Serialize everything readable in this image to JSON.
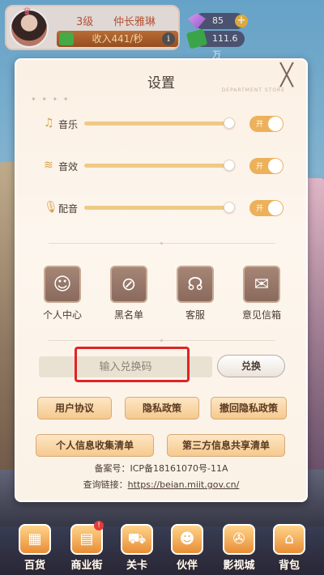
{
  "hud": {
    "level": "3级",
    "rank": "仲长雅琳",
    "income": "收入441/秒",
    "gems": "85",
    "cash": "111.6万"
  },
  "dialog": {
    "title": "设置",
    "brand_text": "DEPARTMENT STORE",
    "audio": [
      {
        "label": "音乐",
        "icon": "music-note-icon",
        "level": 1.0,
        "toggle": "开"
      },
      {
        "label": "音效",
        "icon": "sound-wave-icon",
        "level": 1.0,
        "toggle": "开"
      },
      {
        "label": "配音",
        "icon": "microphone-icon",
        "level": 1.0,
        "toggle": "开"
      }
    ],
    "tiles": [
      {
        "label": "个人中心",
        "icon": "profile-icon"
      },
      {
        "label": "黑名单",
        "icon": "blacklist-icon"
      },
      {
        "label": "客服",
        "icon": "headset-icon"
      },
      {
        "label": "意见信箱",
        "icon": "mailbox-icon"
      }
    ],
    "redeem": {
      "placeholder": "输入兑换码",
      "button": "兑换"
    },
    "buttons": {
      "user_agreement": "用户协议",
      "privacy_policy": "隐私政策",
      "revoke_privacy": "撤回隐私政策",
      "personal_info_list": "个人信息收集清单",
      "third_party_list": "第三方信息共享清单"
    },
    "record": "备案号：ICP备18161070号-11A",
    "query_label": "查询链接：",
    "query_link": "https://beian.miit.gov.cn/"
  },
  "nav": [
    {
      "label": "百货",
      "icon": "store-icon"
    },
    {
      "label": "商业街",
      "icon": "street-icon",
      "badge": "!"
    },
    {
      "label": "关卡",
      "icon": "level-truck-icon"
    },
    {
      "label": "伙伴",
      "icon": "partner-icon"
    },
    {
      "label": "影视城",
      "icon": "film-reel-icon"
    },
    {
      "label": "背包",
      "icon": "backpack-icon"
    }
  ]
}
